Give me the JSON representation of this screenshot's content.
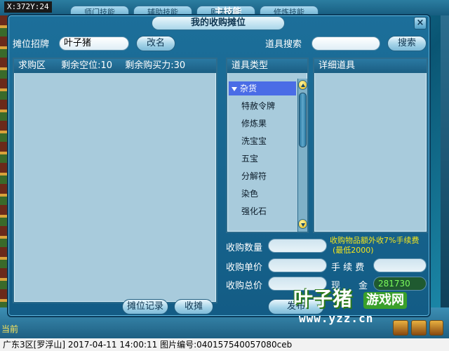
{
  "coord_readout": "X:372Y:24",
  "background": {
    "tabs": [
      "师门技能",
      "辅助技能",
      "剧情技能",
      "修炼技能"
    ],
    "window_title": "主技能",
    "hud_current_label": "当前"
  },
  "window": {
    "title": "我的收购摊位",
    "close_label": "×"
  },
  "stall": {
    "sign_label": "摊位招牌",
    "sign_value": "叶子猪",
    "rename_label": "改名"
  },
  "search": {
    "label": "道具搜索",
    "value": "",
    "button_label": "搜索"
  },
  "purchase_area": {
    "title": "求购区",
    "remaining_slots_label": "剩余空位:10",
    "remaining_power_label": "剩余购买力:30"
  },
  "item_types": {
    "title": "道具类型",
    "selected": "杂货",
    "items": [
      "特赦令牌",
      "修炼果",
      "洗宝宝",
      "五宝",
      "分解符",
      "染色",
      "强化石"
    ]
  },
  "detail": {
    "title": "详细道具"
  },
  "form": {
    "quantity_label": "收购数量",
    "unit_price_label": "收购单价",
    "total_price_label": "收购总价",
    "fee_label": "手 续 费",
    "cash_label": "现　　金",
    "cash_value": "281730",
    "fee_note_line1": "收购物品额外收7%手续费",
    "fee_note_line2": "(最低2000)"
  },
  "buttons": {
    "stall_record": "摊位记录",
    "close_stall": "收摊",
    "publish": "发布"
  },
  "watermark": {
    "name": "叶子猪",
    "suffix": "游戏网",
    "url": "www.yzz.cn"
  },
  "status_bar": "广东3区[罗浮山] 2017-04-11 14:00:11 图片编号:040157540057080ceb",
  "colors": {
    "window_bg": "#1c6f9a",
    "panel_bg": "#a8cbdc",
    "selected_row": "#4a6ce6",
    "fee_note": "#f5e61c",
    "cash_text": "#7cfc5c"
  }
}
